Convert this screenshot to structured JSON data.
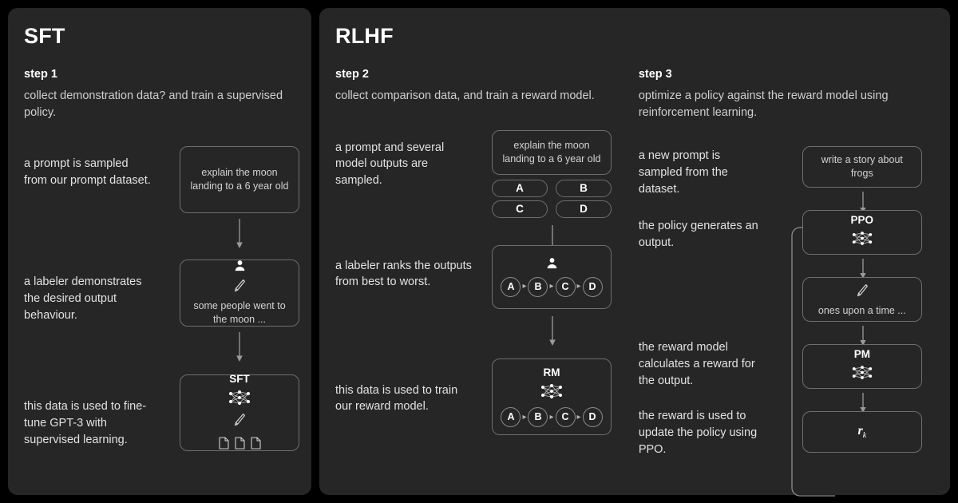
{
  "panels": [
    {
      "title": "SFT",
      "steps": [
        {
          "label": "step 1",
          "desc": "collect demonstration data? and train a supervised policy.",
          "captions": [
            "a prompt is sampled from our prompt dataset.",
            "a labeler demonstrates the desired output behaviour.",
            "this data is used to fine-tune GPT-3 with supervised learning."
          ],
          "cards": {
            "prompt": "explain the moon landing to a 6 year old",
            "demo": "some people went to the moon ...",
            "model_title": "SFT"
          }
        }
      ]
    },
    {
      "title": "RLHF",
      "steps": [
        {
          "label": "step 2",
          "desc": "collect comparison data, and train a reward model.",
          "captions": [
            "a prompt and several model outputs are sampled.",
            "a labeler ranks the outputs from best to worst.",
            "this data is used to train our reward model."
          ],
          "cards": {
            "prompt": "explain the moon landing to a 6 year old",
            "options": [
              "A",
              "B",
              "C",
              "D"
            ],
            "ranking": [
              "A",
              "B",
              "C",
              "D"
            ],
            "model_title": "RM",
            "rm_ranking": [
              "A",
              "B",
              "C",
              "D"
            ]
          }
        },
        {
          "label": "step 3",
          "desc": "optimize a policy against the reward model using reinforcement learning.",
          "captions": [
            "a new prompt is sampled from the dataset.",
            "the policy generates an output.",
            "the reward model calculates a reward for the output.",
            "the reward is used to update the policy using PPO."
          ],
          "cards": {
            "prompt": "write a story about frogs",
            "policy_title": "PPO",
            "output": "ones upon a time ...",
            "reward_model_title": "PM",
            "reward_symbol": "r",
            "reward_subscript": "k"
          }
        }
      ]
    }
  ],
  "icons": {
    "person": "person-icon",
    "pencil": "pencil-icon",
    "neural_net": "neural-network-icon",
    "document": "document-icon",
    "arrow_down": "arrow-down-icon",
    "rank_arrow": "arrow-right-small-icon"
  },
  "colors": {
    "page_background": "#000000",
    "panel_background": "#262626",
    "card_border": "#6e6e6e",
    "heading_text": "#ffffff",
    "body_text": "#d7d7d7",
    "arrow": "#9a9a9a"
  }
}
